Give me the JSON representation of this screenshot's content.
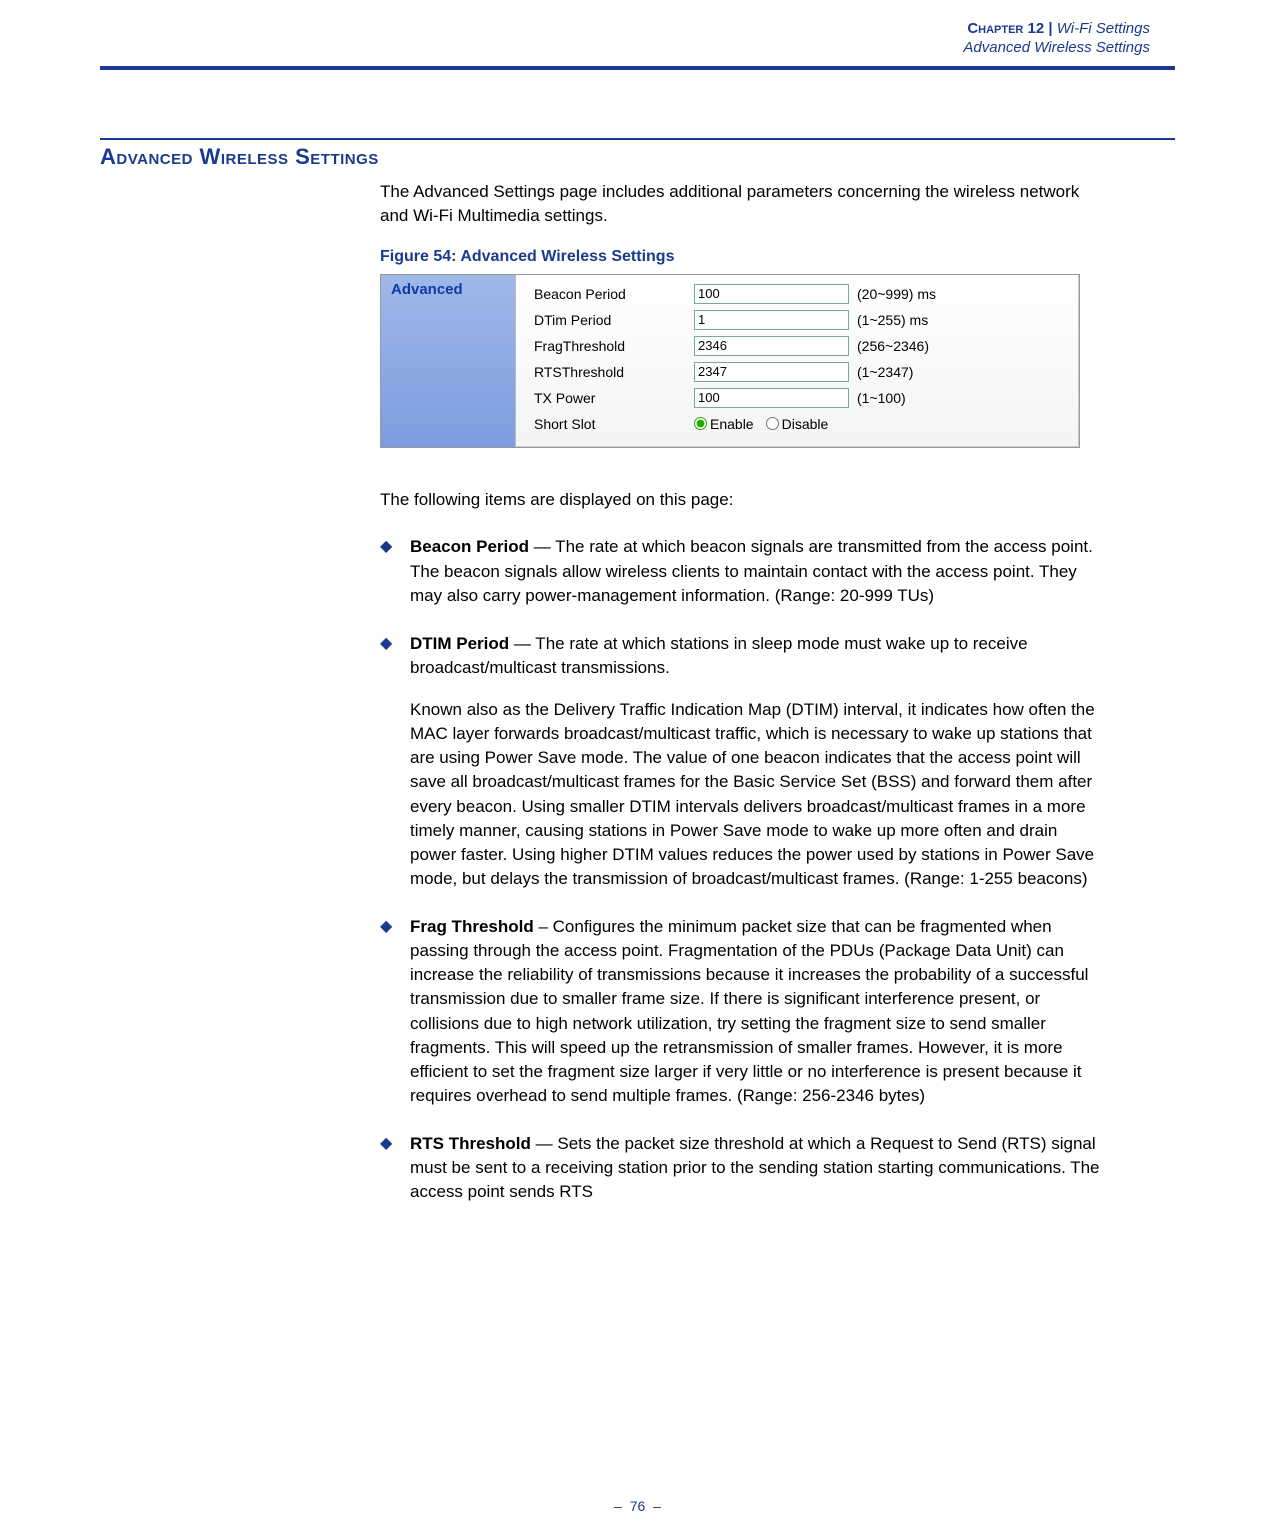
{
  "header": {
    "chapter": "Chapter 12",
    "separator": "|",
    "title": "Wi-Fi Settings",
    "subtitle": "Advanced Wireless Settings"
  },
  "section": {
    "heading": "Advanced Wireless Settings",
    "intro": "The Advanced Settings page includes additional parameters concerning the wireless network and Wi-Fi Multimedia settings."
  },
  "figure": {
    "caption": "Figure 54:  Advanced Wireless Settings",
    "panel_title": "Advanced",
    "rows": [
      {
        "label": "Beacon Period",
        "value": "100",
        "suffix": "(20~999) ms"
      },
      {
        "label": "DTim Period",
        "value": "1",
        "suffix": "(1~255) ms"
      },
      {
        "label": "FragThreshold",
        "value": "2346",
        "suffix": "(256~2346)"
      },
      {
        "label": "RTSThreshold",
        "value": "2347",
        "suffix": "(1~2347)"
      },
      {
        "label": "TX Power",
        "value": "100",
        "suffix": "(1~100)"
      }
    ],
    "radio_row": {
      "label": "Short Slot",
      "enable": "Enable",
      "disable": "Disable"
    }
  },
  "followup": "The following items are displayed on this page:",
  "bullets": [
    {
      "term": "Beacon Period",
      "text": " — The rate at which beacon signals are transmitted from the access point. The beacon signals allow wireless clients to maintain contact with the access point. They may also carry power-management information. (Range: 20-999 TUs)"
    },
    {
      "term": "DTIM Period",
      "text": " — The rate at which stations in sleep mode must wake up to receive broadcast/multicast transmissions.",
      "extra": "Known also as the Delivery Traffic Indication Map (DTIM) interval, it indicates how often the MAC layer forwards broadcast/multicast traffic, which is necessary to wake up stations that are using Power Save mode. The value of one beacon indicates that the access point will save all broadcast/multicast frames for the Basic Service Set (BSS) and forward them after every beacon. Using smaller DTIM intervals delivers broadcast/multicast frames in a more timely manner, causing stations in Power Save mode to wake up more often and drain power faster. Using higher DTIM values reduces the power used by stations in Power Save mode, but delays the transmission of broadcast/multicast frames. (Range: 1-255 beacons)"
    },
    {
      "term": "Frag Threshold",
      "text": " – Configures the minimum packet size that can be fragmented when passing through the access point. Fragmentation of the PDUs (Package Data Unit) can increase the reliability of transmissions because it increases the probability of a successful transmission due to smaller frame size. If there is significant interference present, or collisions due to high network utilization, try setting the fragment size to send smaller fragments. This will speed up the retransmission of smaller frames. However, it is more efficient to set the fragment size larger if very little or no interference is present because it requires overhead to send multiple frames. (Range: 256-2346 bytes)"
    },
    {
      "term": "RTS Threshold",
      "text": " — Sets the packet size threshold at which a Request to Send (RTS) signal must be sent to a receiving station prior to the sending station starting communications. The access point sends RTS"
    }
  ],
  "footer": {
    "page": "76"
  }
}
